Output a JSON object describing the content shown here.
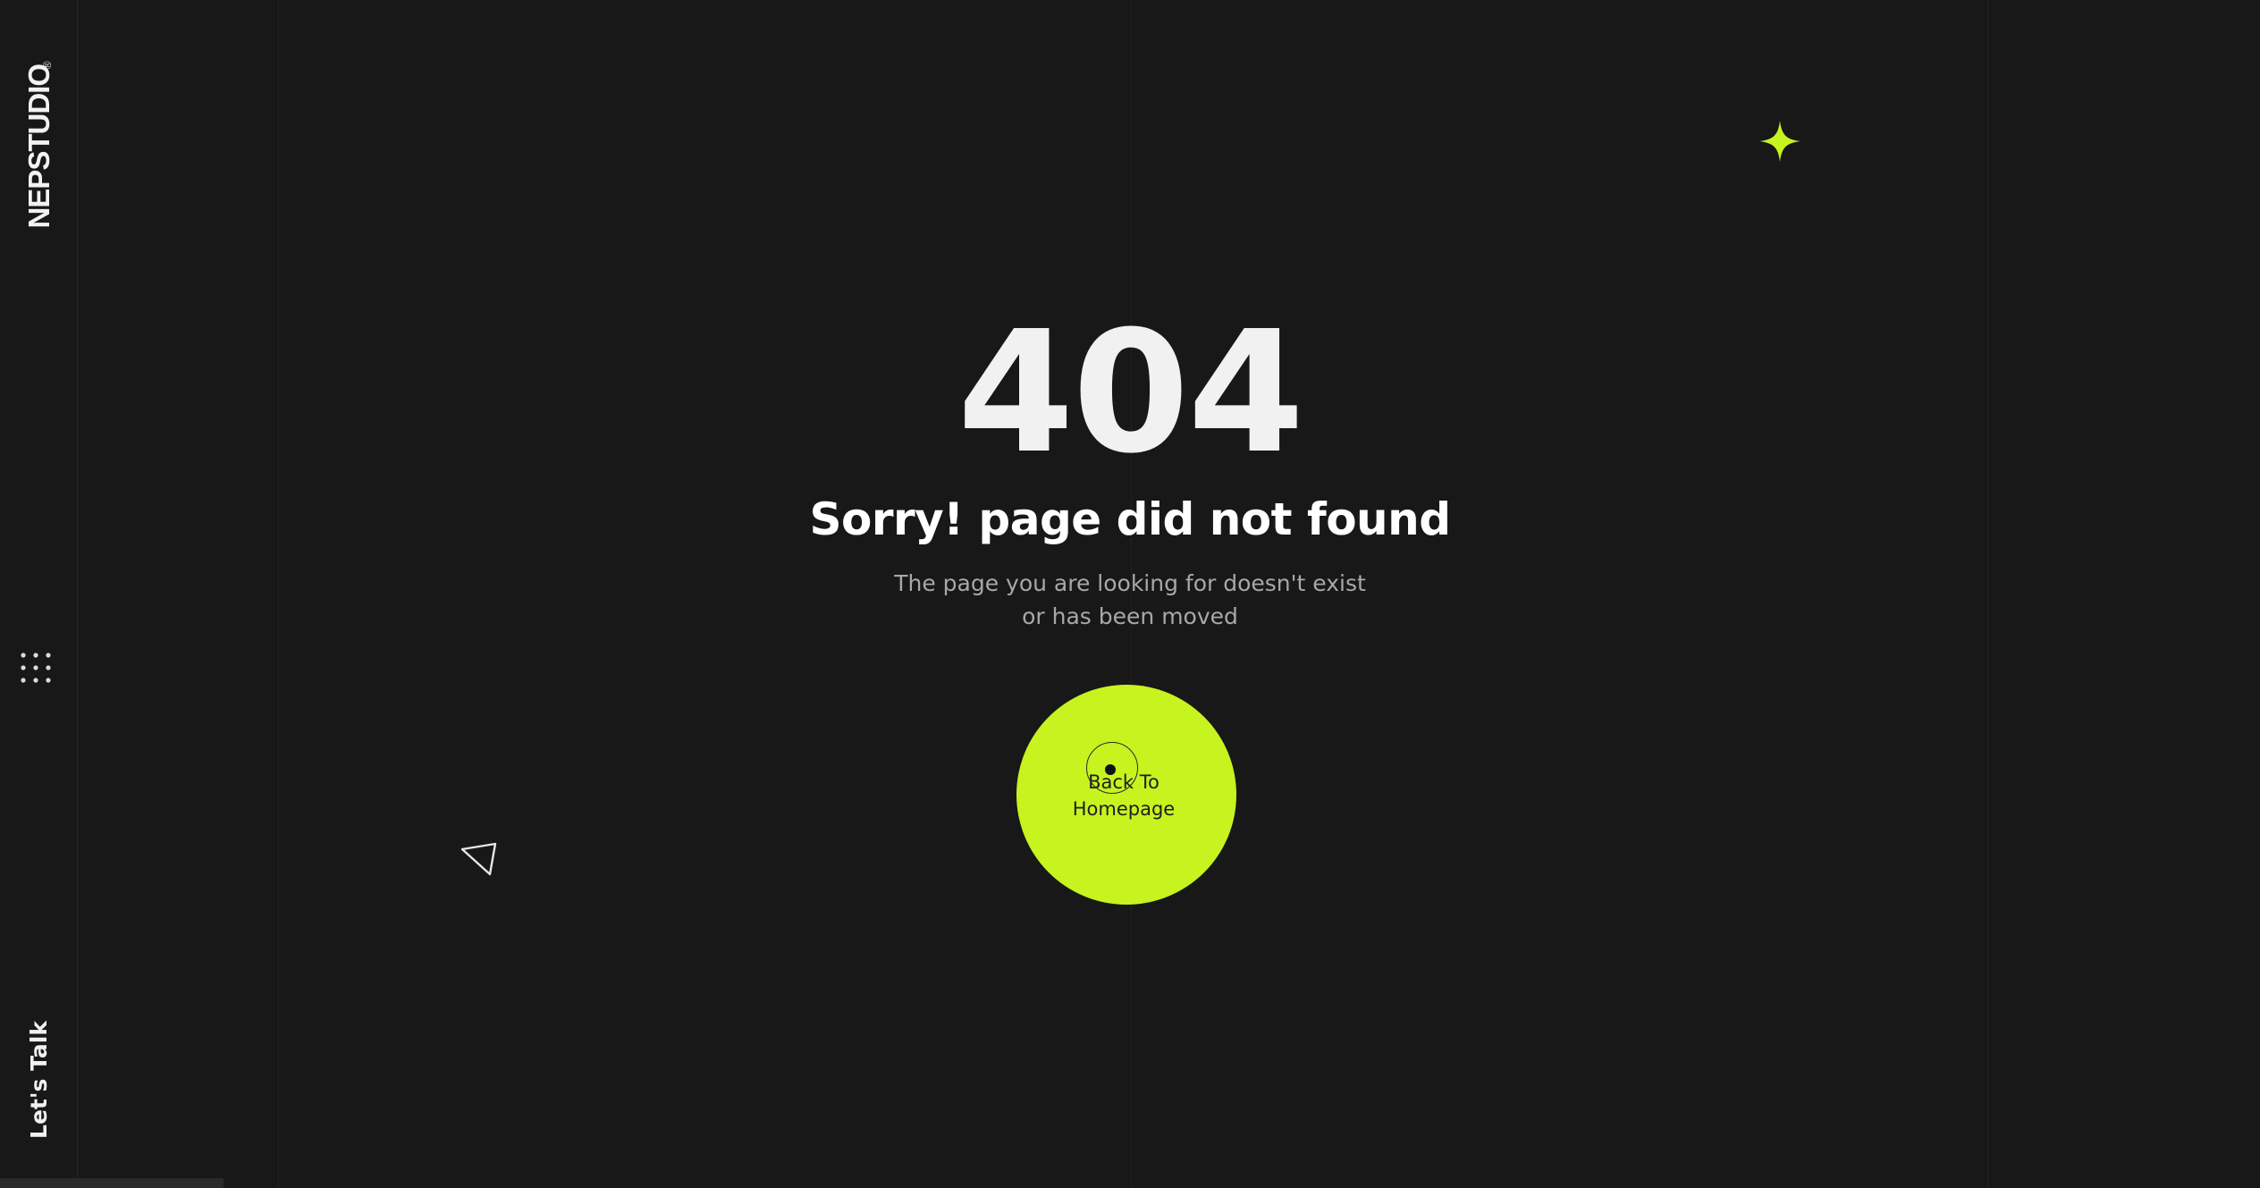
{
  "brand": {
    "name": "NEPSTUDIO",
    "registered_mark": "®"
  },
  "sidebar": {
    "menu_icon": "grid-dots-icon",
    "cta_label": "Let's Talk"
  },
  "error": {
    "code": "404",
    "headline": "Sorry! page did not found",
    "description_line_1": "The page you are looking for doesn't exist",
    "description_line_2": "or has been moved"
  },
  "home_button": {
    "label_line_1": "Back To",
    "label_line_2": "Homepage"
  },
  "decorations": {
    "sparkle_icon": "sparkle-star-icon",
    "triangle_icon": "triangle-outline-icon"
  },
  "colors": {
    "background": "#181818",
    "accent": "#c7f31f",
    "text_primary": "#f1f1f1",
    "text_muted": "#a8a8a8"
  }
}
